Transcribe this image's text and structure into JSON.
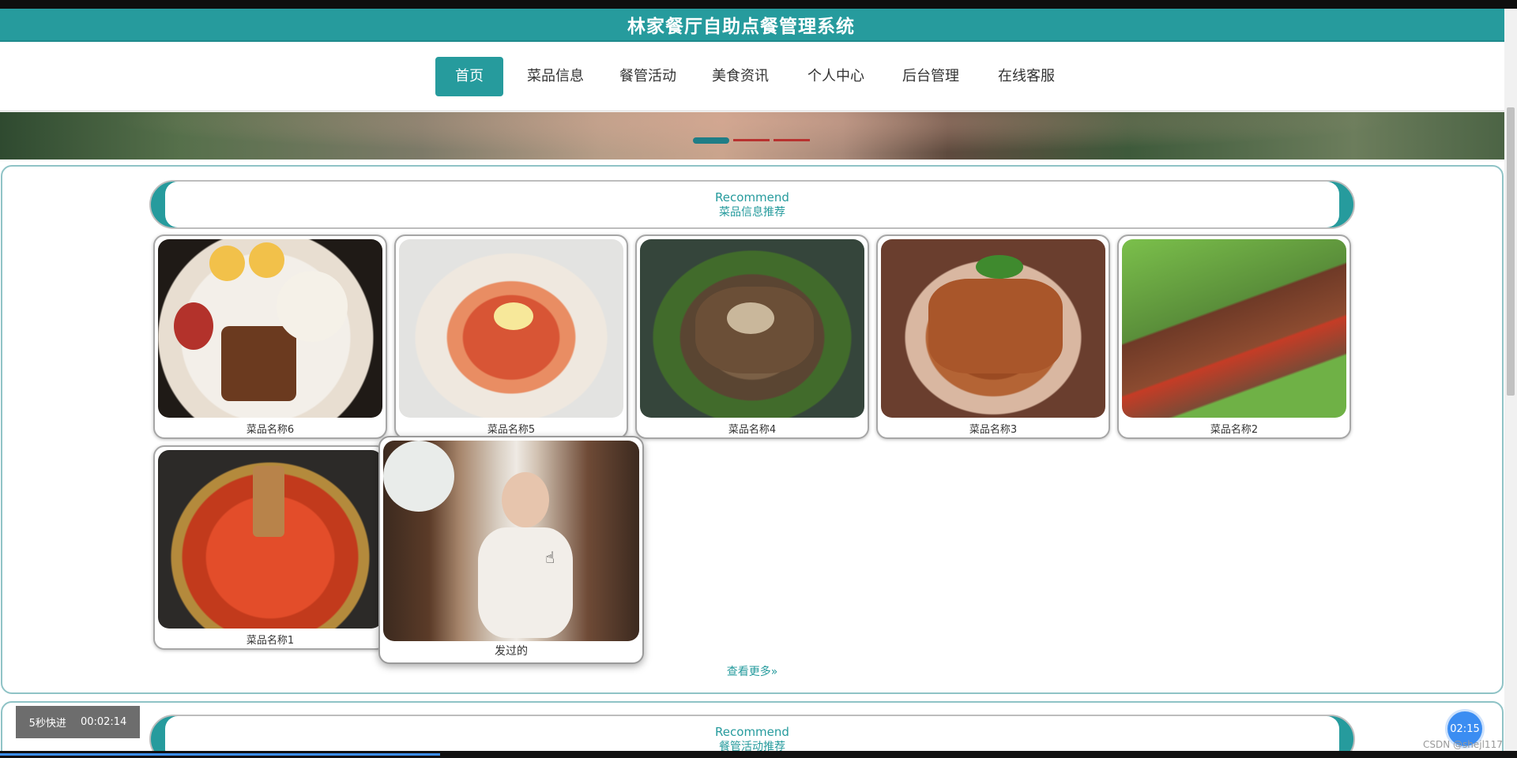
{
  "app": {
    "title": "林家餐厅自助点餐管理系统"
  },
  "nav": {
    "items": [
      {
        "label": "首页",
        "active": true
      },
      {
        "label": "菜品信息",
        "active": false
      },
      {
        "label": "餐管活动",
        "active": false
      },
      {
        "label": "美食资讯",
        "active": false
      },
      {
        "label": "个人中心",
        "active": false
      },
      {
        "label": "后台管理",
        "active": false
      },
      {
        "label": "在线客服",
        "active": false
      }
    ]
  },
  "banner": {
    "slides": 3,
    "active_slide": 1
  },
  "recommend": {
    "heading_en": "Recommend",
    "heading_cn": "菜品信息推荐",
    "cards": [
      {
        "name": "菜品名称6",
        "image": "waffle-breakfast-image"
      },
      {
        "name": "菜品名称5",
        "image": "tomato-egg-plate-image"
      },
      {
        "name": "菜品名称4",
        "image": "fried-mushroom-image"
      },
      {
        "name": "菜品名称3",
        "image": "braised-pork-image"
      },
      {
        "name": "菜品名称2",
        "image": "beef-skewer-image"
      },
      {
        "name": "菜品名称1",
        "image": "hotpot-image"
      },
      {
        "name": "发过的",
        "image": "woman-portrait-image"
      }
    ],
    "more_label": "查看更多»"
  },
  "activity": {
    "heading_en": "Recommend",
    "heading_cn": "餐管活动推荐"
  },
  "player": {
    "fast_forward_label": "5秒快进",
    "elapsed": "00:02:14",
    "timer_badge": "02:15",
    "progress": 0.29
  },
  "watermark": "CSDN @shejl117"
}
